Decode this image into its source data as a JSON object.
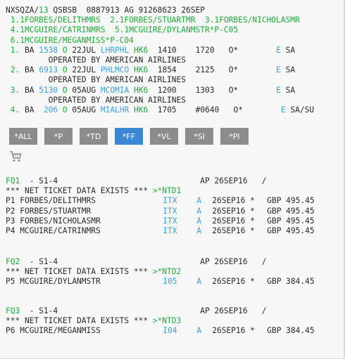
{
  "pnr_header": {
    "locator": "NXSQZA",
    "agent": "13",
    "office": "QSBSB",
    "ids": "0887913 AG 91268623",
    "date": "26SEP"
  },
  "names": [
    {
      "num": "1.1",
      "name": "FORBES/DELITHMRS"
    },
    {
      "num": "2.1",
      "name": "FORBES/STUARTMR"
    },
    {
      "num": "3.1",
      "name": "FORBES/NICHOLASMR"
    },
    {
      "num": "4.1",
      "name": "MCGUIRE/CATRINMRS"
    },
    {
      "num": "5.1",
      "name": "MCGUIRE/DYLANMSTR*P-C05"
    },
    {
      "num": "6.1",
      "name": "MCGUIRE/MEGANMISS*P-C04"
    }
  ],
  "segments": [
    {
      "num": "1.",
      "airline": "BA",
      "flight": "1538",
      "cls": "O",
      "date": "22JUL",
      "route": "LHRPHL",
      "status": "HK6",
      "dep": "1410",
      "arr": "1720",
      "flag": "O*",
      "e": "E",
      "days": "SA",
      "operated": "OPERATED BY AMERICAN AIRLINES"
    },
    {
      "num": "2.",
      "airline": "BA",
      "flight": "6913",
      "cls": "O",
      "date": "22JUL",
      "route": "PHLMCO",
      "status": "HK6",
      "dep": "1854",
      "arr": "2125",
      "flag": "O*",
      "e": "E",
      "days": "SA",
      "operated": "OPERATED BY AMERICAN AIRLINES"
    },
    {
      "num": "3.",
      "airline": "BA",
      "flight": "5130",
      "cls": "O",
      "date": "05AUG",
      "route": "MCOMIA",
      "status": "HK6",
      "dep": "1200",
      "arr": "1303",
      "flag": "O*",
      "e": "E",
      "days": "SA",
      "operated": "OPERATED BY AMERICAN AIRLINES"
    },
    {
      "num": "4.",
      "airline": "BA",
      "flight": "206",
      "cls": "O",
      "date": "05AUG",
      "route": "MIALHR",
      "status": "HK6",
      "dep": "1705",
      "arr": "#0640",
      "flag": "O*",
      "e": "E",
      "days": "SA/SU",
      "operated": ""
    }
  ],
  "buttons": [
    {
      "label": "*ALL",
      "active": false
    },
    {
      "label": "*P",
      "active": false
    },
    {
      "label": "*TD",
      "active": false
    },
    {
      "label": "*FF",
      "active": true
    },
    {
      "label": "*VL",
      "active": false
    },
    {
      "label": "*SI",
      "active": false
    },
    {
      "label": "*PI",
      "active": false
    }
  ],
  "cart_icon": "shopping-cart-icon",
  "fare_quotes": [
    {
      "id": "FQ1",
      "segments": "- S1-4",
      "ap": "AP 26SEP16",
      "slash": "/",
      "net_text": "*** NET TICKET DATA EXISTS ***",
      "net_link": ">*NTD1",
      "pax": [
        {
          "p": "P1",
          "name": "FORBES/DELITHMRS",
          "code": "ITX",
          "a": "A",
          "date": "26SEP16 *",
          "fare": "GBP 495.45"
        },
        {
          "p": "P2",
          "name": "FORBES/STUARTMR",
          "code": "ITX",
          "a": "A",
          "date": "26SEP16 *",
          "fare": "GBP 495.45"
        },
        {
          "p": "P3",
          "name": "FORBES/NICHOLASMR",
          "code": "ITX",
          "a": "A",
          "date": "26SEP16 *",
          "fare": "GBP 495.45"
        },
        {
          "p": "P4",
          "name": "MCGUIRE/CATRINMRS",
          "code": "ITX",
          "a": "A",
          "date": "26SEP16 *",
          "fare": "GBP 495.45"
        }
      ]
    },
    {
      "id": "FQ2",
      "segments": "- S1-4",
      "ap": "AP 26SEP16",
      "slash": "/",
      "net_text": "*** NET TICKET DATA EXISTS ***",
      "net_link": ">*NTD2",
      "pax": [
        {
          "p": "P5",
          "name": "MCGUIRE/DYLANMSTR",
          "code": "I05",
          "a": "A",
          "date": "26SEP16 *",
          "fare": "GBP 384.45"
        }
      ]
    },
    {
      "id": "FQ3",
      "segments": "- S1-4",
      "ap": "AP 26SEP16",
      "slash": "/",
      "net_text": "*** NET TICKET DATA EXISTS ***",
      "net_link": ">*NTD3",
      "pax": [
        {
          "p": "P6",
          "name": "MCGUIRE/MEGANMISS",
          "code": "I04",
          "a": "A",
          "date": "26SEP16 *",
          "fare": "GBP 384.45"
        }
      ]
    }
  ],
  "colors": {
    "green": "#22a93b",
    "blue": "#3d9fe0",
    "button": "#8c8c8c",
    "button_active": "#3c87d4"
  }
}
